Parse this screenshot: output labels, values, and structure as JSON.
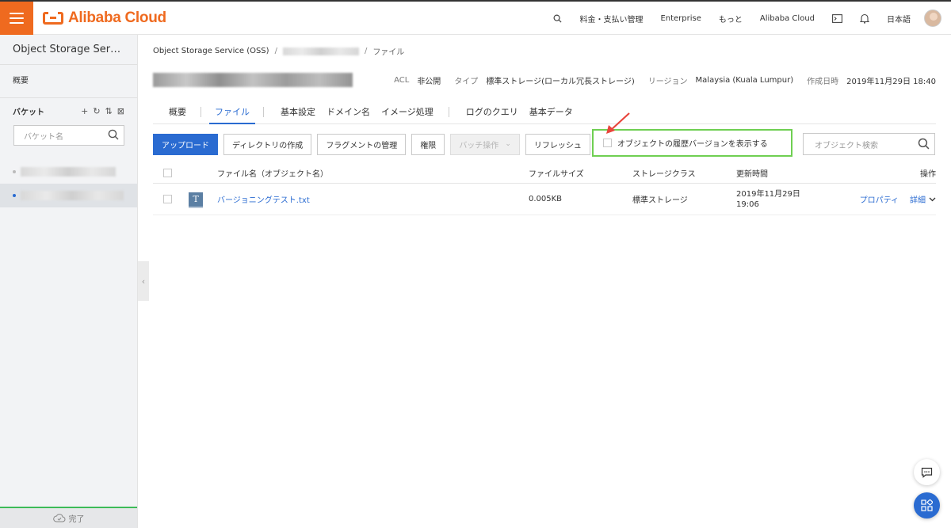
{
  "topbar": {
    "brand": "Alibaba Cloud",
    "search_icon": "search-icon",
    "nav_billing": "料金・支払い管理",
    "nav_enterprise": "Enterprise",
    "nav_more": "もっと",
    "nav_alibaba": "Alibaba Cloud",
    "terminal_icon": "terminal-icon",
    "bell_icon": "bell-icon",
    "language": "日本語",
    "accent_color": "#ef6a1f"
  },
  "sidebar": {
    "title": "Object Storage Servic···",
    "overview": "概要",
    "bucket_heading": "バケット",
    "bucket_search_placeholder": "バケット名",
    "footer_status": "完了",
    "tool_icons": [
      "plus-icon",
      "refresh-icon",
      "sort-icon",
      "expand-icon"
    ]
  },
  "breadcrumb": {
    "root": "Object Storage Service (OSS)",
    "sep1": "/",
    "sep2": "/",
    "current": "ファイル"
  },
  "bucket_info": {
    "acl_label": "ACL",
    "acl_value": "非公開",
    "type_label": "タイプ",
    "type_value": "標準ストレージ(ローカル冗長ストレージ)",
    "region_label": "リージョン",
    "region_value": "Malaysia (Kuala Lumpur)",
    "created_label": "作成日時",
    "created_value": "2019年11月29日 18:40"
  },
  "tabs": {
    "overview": "概要",
    "files": "ファイル",
    "basic_settings": "基本設定",
    "domain": "ドメイン名",
    "image": "イメージ処理",
    "log_query": "ログのクエリ",
    "basic_data": "基本データ"
  },
  "toolbar": {
    "upload": "アップロード",
    "create_dir": "ディレクトリの作成",
    "fragments": "フラグメントの管理",
    "permissions": "権限",
    "batch": "バッチ操作",
    "refresh": "リフレッシュ",
    "show_history": "オブジェクトの履歴バージョンを表示する",
    "search_placeholder": "オブジェクト検索",
    "primary_color": "#2a6bd1",
    "highlight_color": "#6fcf52",
    "arrow_color": "#e8453c"
  },
  "table": {
    "headers": {
      "name": "ファイル名（オブジェクト名）",
      "size": "ファイルサイズ",
      "storage_class": "ストレージクラス",
      "updated": "更新時間",
      "actions": "操作"
    },
    "rows": [
      {
        "icon_letter": "T",
        "name": "バージョニングテスト.txt",
        "size": "0.005KB",
        "storage_class": "標準ストレージ",
        "updated_date": "2019年11月29日",
        "updated_time": "19:06",
        "properties": "プロパティ",
        "details": "詳細"
      }
    ]
  },
  "floating": {
    "chat_icon": "chat-icon",
    "apps_icon": "apps-icon"
  }
}
